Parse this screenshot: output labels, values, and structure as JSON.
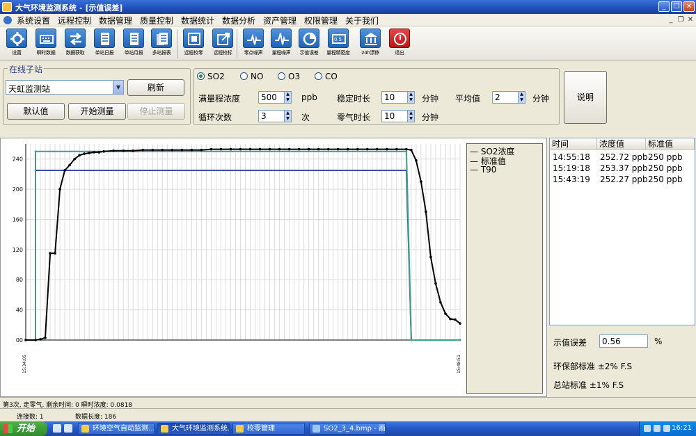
{
  "window": {
    "title": "大气环境监测系统 - [示值误差]",
    "controls": [
      "_",
      "❐",
      "✕"
    ]
  },
  "menu": {
    "items": [
      "系统设置",
      "远程控制",
      "数据管理",
      "质量控制",
      "数据统计",
      "数据分析",
      "资产管理",
      "权限管理",
      "关于我们"
    ],
    "mdi_controls": [
      "_",
      "❐",
      "✕"
    ]
  },
  "toolbar": {
    "buttons": [
      {
        "label": "设置",
        "icon": "gear-icon"
      },
      {
        "label": "瞬时数据",
        "icon": "keyboard-icon"
      },
      {
        "label": "数据获取",
        "icon": "transfer-arrows-icon"
      },
      {
        "label": "单站日报",
        "icon": "report-icon"
      },
      {
        "label": "单站月报",
        "icon": "report-icon"
      },
      {
        "label": "多站报表",
        "icon": "multi-report-icon"
      },
      {
        "label": "远程校零",
        "icon": "remote-zero-icon"
      },
      {
        "label": "远程校标",
        "icon": "remote-span-icon"
      },
      {
        "label": "零点噪声",
        "icon": "pulse-wave-icon"
      },
      {
        "label": "量程噪声",
        "icon": "pulse-wave-icon"
      },
      {
        "label": "示值误差",
        "icon": "pie-chart-icon"
      },
      {
        "label": "量程精密度",
        "icon": "precision-icon"
      },
      {
        "label": "24h漂移",
        "icon": "bank-icon"
      },
      {
        "label": "退出",
        "icon": "power-icon"
      }
    ]
  },
  "station": {
    "group_title": "在线子站",
    "selected": "天虹监测站",
    "refresh_label": "刷新",
    "default_label": "默认值",
    "start_label": "开始测量",
    "stop_label": "停止测量"
  },
  "gases": {
    "options": [
      "SO2",
      "NO",
      "O3",
      "CO"
    ],
    "selected": "SO2"
  },
  "params": {
    "full_scale_label": "满量程浓度",
    "full_scale_value": "500",
    "full_scale_unit": "ppb",
    "cycles_label": "循环次数",
    "cycles_value": "3",
    "cycles_unit": "次",
    "stable_label": "稳定时长",
    "stable_value": "10",
    "stable_unit": "分钟",
    "zero_label": "零气时长",
    "zero_value": "10",
    "zero_unit": "分钟",
    "avg_label": "平均值",
    "avg_value": "2",
    "avg_unit": "分钟"
  },
  "explain_label": "说明",
  "chart_data": {
    "type": "line",
    "ylim": [
      0,
      260
    ],
    "yticks": [
      "240",
      "200",
      "160",
      "120",
      "80",
      "40",
      "00"
    ],
    "ytick_values": [
      240,
      200,
      160,
      120,
      80,
      40,
      0
    ],
    "x_first": "15:34:05",
    "x_last": "15:48:51",
    "series": [
      {
        "name": "SO2浓度",
        "color": "#000000",
        "points": [
          [
            0,
            0
          ],
          [
            2,
            0
          ],
          [
            3,
            1
          ],
          [
            4,
            3
          ],
          [
            5,
            115
          ],
          [
            6,
            115
          ],
          [
            7,
            200
          ],
          [
            8,
            225
          ],
          [
            9,
            232
          ],
          [
            10,
            240
          ],
          [
            11,
            245
          ],
          [
            12,
            247
          ],
          [
            13,
            248
          ],
          [
            14,
            249
          ],
          [
            15,
            249
          ],
          [
            16,
            250
          ],
          [
            18,
            251
          ],
          [
            20,
            251
          ],
          [
            22,
            251
          ],
          [
            24,
            252
          ],
          [
            26,
            252
          ],
          [
            28,
            252
          ],
          [
            30,
            252
          ],
          [
            32,
            252
          ],
          [
            34,
            252
          ],
          [
            36,
            252
          ],
          [
            38,
            253
          ],
          [
            40,
            253
          ],
          [
            42,
            253
          ],
          [
            44,
            253
          ],
          [
            46,
            253
          ],
          [
            48,
            253
          ],
          [
            50,
            253
          ],
          [
            52,
            253
          ],
          [
            54,
            253
          ],
          [
            56,
            253
          ],
          [
            58,
            253
          ],
          [
            60,
            253
          ],
          [
            62,
            253
          ],
          [
            64,
            253
          ],
          [
            66,
            253
          ],
          [
            68,
            253
          ],
          [
            70,
            253
          ],
          [
            72,
            253
          ],
          [
            74,
            253
          ],
          [
            76,
            253
          ],
          [
            78,
            253
          ],
          [
            79,
            252
          ],
          [
            80,
            238
          ],
          [
            81,
            210
          ],
          [
            82,
            170
          ],
          [
            83,
            110
          ],
          [
            84,
            75
          ],
          [
            85,
            50
          ],
          [
            86,
            35
          ],
          [
            87,
            28
          ],
          [
            88,
            27
          ],
          [
            89,
            22
          ]
        ]
      },
      {
        "name": "标准值",
        "color": "#3aa08a",
        "points": [
          [
            0,
            0
          ],
          [
            2,
            0
          ],
          [
            2,
            250
          ],
          [
            78,
            250
          ],
          [
            79,
            0
          ],
          [
            89,
            0
          ]
        ]
      },
      {
        "name": "T90",
        "color": "#3a4fa0",
        "points": [
          [
            0,
            0
          ],
          [
            2,
            0
          ],
          [
            2,
            225
          ],
          [
            78,
            225
          ],
          [
            79,
            0
          ],
          [
            89,
            0
          ]
        ]
      }
    ]
  },
  "legend": {
    "items": [
      "SO2浓度",
      "标准值",
      "T90"
    ]
  },
  "table": {
    "headers": [
      "时间",
      "浓度值",
      "标准值"
    ],
    "rows": [
      [
        "14:55:18",
        "252.72 ppb",
        "250 ppb"
      ],
      [
        "15:19:18",
        "253.37 ppb",
        "250 ppb"
      ],
      [
        "15:43:19",
        "252.27 ppb",
        "250 ppb"
      ]
    ]
  },
  "result": {
    "error_label": "示值误差",
    "error_value": "0.56",
    "error_unit": "%",
    "std1": "环保部标准 ±2% F.S",
    "std2": "总站标准 ±1% F.S"
  },
  "status": {
    "line1": "第3次, 走零气, 剩余时间: 0 瞬时浓度: 0.0818",
    "connections": "连接数: 1",
    "data_length": "数据长度: 186"
  },
  "taskbar": {
    "start": "开始",
    "tasks": [
      "环境空气自动监测...",
      "大气环境监测系统...",
      "校零管理",
      "SO2_3_4.bmp - 画图"
    ],
    "clock": "16:21"
  }
}
